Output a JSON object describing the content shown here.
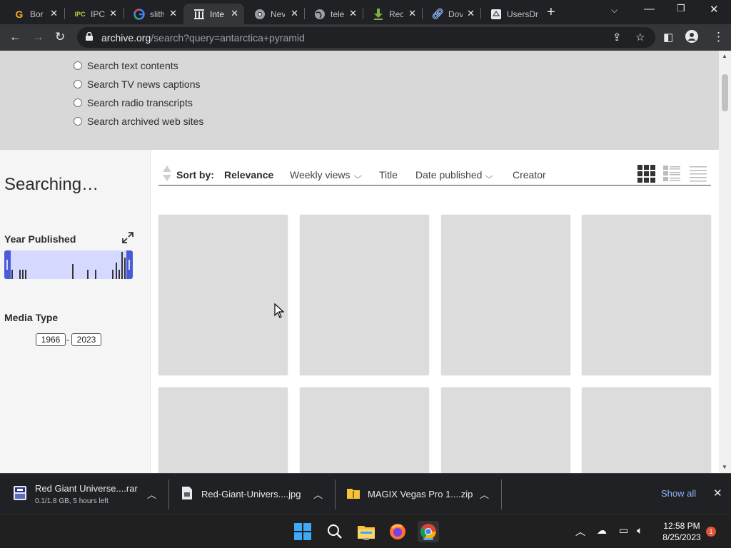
{
  "browser": {
    "tabs": [
      {
        "title": "Bor",
        "icon": "g-letter-icon",
        "color": "#f9a825"
      },
      {
        "title": "IPC",
        "icon": "ipc-logo-icon",
        "color": "#c0ca33"
      },
      {
        "title": "slith",
        "icon": "google-icon",
        "color": "#4285f4"
      },
      {
        "title": "Inte",
        "icon": "archive-building-icon",
        "color": "#e8eaed",
        "active": true
      },
      {
        "title": "Nev",
        "icon": "chrome-icon",
        "color": "#e8eaed"
      },
      {
        "title": "tele",
        "icon": "globe-icon",
        "color": "#9aa0a6"
      },
      {
        "title": "Red",
        "icon": "download-arrow-icon",
        "color": "#7cb342"
      },
      {
        "title": "Dov",
        "icon": "link-icon",
        "color": "#8ab4f8"
      },
      {
        "title": "UsersDr",
        "icon": "drive-icon",
        "color": "#e8eaed"
      }
    ],
    "url_host": "archive.org",
    "url_rest": "/search?query=antarctica+pyramid"
  },
  "search_options": [
    "Search text contents",
    "Search TV news captions",
    "Search radio transcripts",
    "Search archived web sites"
  ],
  "sidebar": {
    "status": "Searching…",
    "year_facet_title": "Year Published",
    "year_min": "1966",
    "year_max": "2023",
    "media_facet_title": "Media Type"
  },
  "sort": {
    "label": "Sort by:",
    "options": [
      "Relevance",
      "Weekly views",
      "Title",
      "Date published",
      "Creator"
    ],
    "selected": "Relevance"
  },
  "downloads": [
    {
      "name": "Red Giant Universe....rar",
      "status": "0.1/1.8 GB, 5 hours left",
      "icon": "rar-archive-icon"
    },
    {
      "name": "Red-Giant-Univers....jpg",
      "status": "",
      "icon": "image-file-icon"
    },
    {
      "name": "MAGIX Vegas Pro 1....zip",
      "status": "",
      "icon": "zip-folder-icon"
    }
  ],
  "downloads_show_all": "Show all",
  "taskbar": {
    "time": "12:58 PM",
    "date": "8/25/2023",
    "notifications": "1"
  },
  "colors": {
    "accent": "#4a5bd9",
    "link": "#8ab4f8"
  }
}
